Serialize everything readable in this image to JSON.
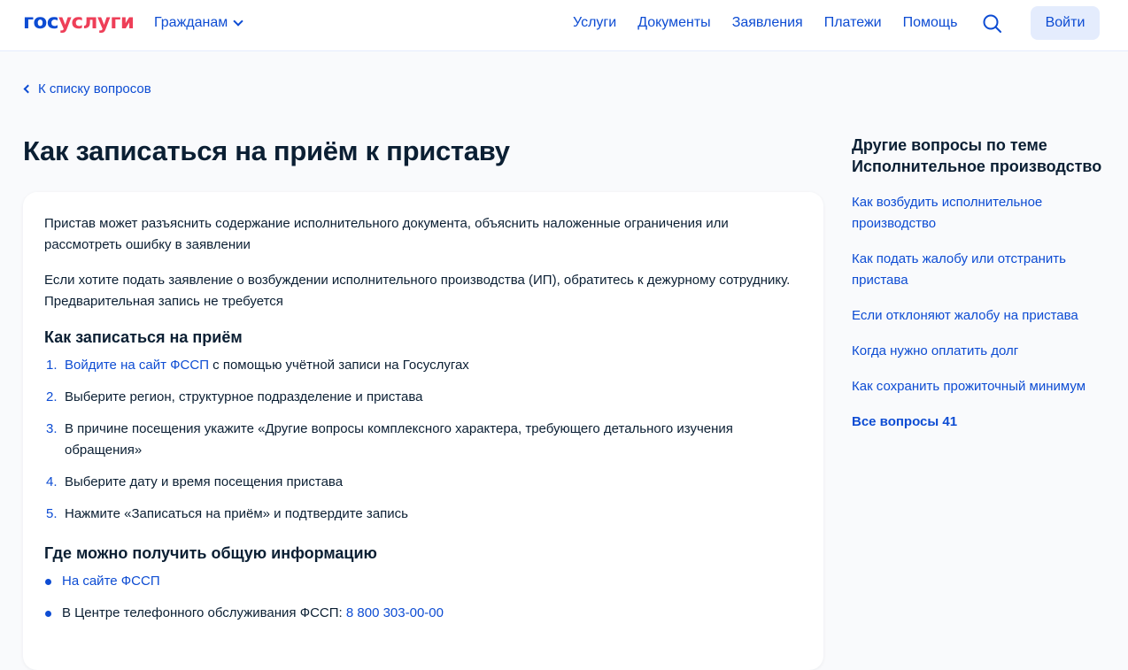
{
  "header": {
    "logo_part1": "гос",
    "logo_part2": "услуги",
    "audience": "Гражданам",
    "nav": [
      "Услуги",
      "Документы",
      "Заявления",
      "Платежи",
      "Помощь"
    ],
    "login_label": "Войти",
    "icons": {
      "search": "search-icon",
      "chevron": "chevron-down-icon"
    }
  },
  "breadcrumb": {
    "back_label": "К списку вопросов"
  },
  "page_title": "Как записаться на приём к приставу",
  "content": {
    "intro": [
      "Пристав может разъяснить содержание исполнительного документа, объяснить наложенные ограничения или рассмотреть ошибку в заявлении",
      "Если хотите подать заявление о возбуждении исполнительного производства (ИП), обратитесь к дежурному сотруднику. Предварительная запись не требуется"
    ],
    "section1": {
      "heading": "Как записаться на приём",
      "steps": [
        {
          "num": "1.",
          "link": "Войдите на сайт ФССП",
          "text": " с помощью учётной записи на Госуслугах"
        },
        {
          "num": "2.",
          "text": "Выберите регион, структурное подразделение и пристава"
        },
        {
          "num": "3.",
          "text": "В причине посещения укажите «Другие вопросы комплексного характера, требующего детального изучения обращения»"
        },
        {
          "num": "4.",
          "text": "Выберите дату и время посещения пристава"
        },
        {
          "num": "5.",
          "text": "Нажмите «Записаться на приём» и подтвердите запись"
        }
      ]
    },
    "section2": {
      "heading": "Где можно получить общую информацию",
      "items": [
        {
          "link": "На сайте ФССП"
        },
        {
          "text": "В Центре телефонного обслуживания ФССП: ",
          "phone": "8 800 303-00-00"
        }
      ]
    }
  },
  "aside": {
    "title": "Другие вопросы по теме Исполнительное производство",
    "links": [
      "Как возбудить исполнительное производство",
      "Как подать жалобу или отстранить пристава",
      "Если отклоняют жалобу на пристава",
      "Когда нужно оплатить долг",
      "Как сохранить прожиточный минимум"
    ],
    "all_label": "Все вопросы 41"
  },
  "colors": {
    "accent": "#0d4cd3",
    "brand_red": "#ee3f58",
    "text": "#0b1f33",
    "background": "#f9fafc"
  }
}
